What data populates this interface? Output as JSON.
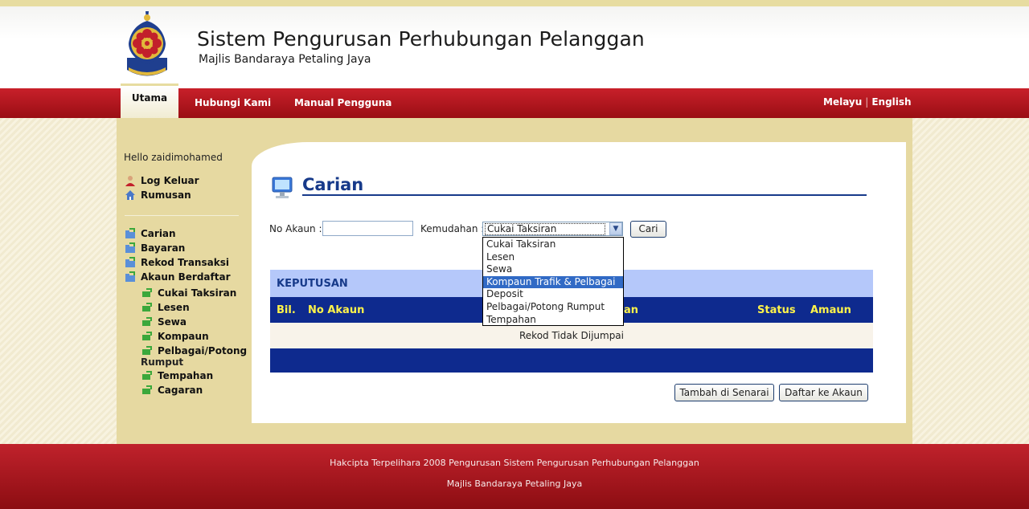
{
  "header": {
    "title": "Sistem Pengurusan Perhubungan Pelanggan",
    "subtitle": "Majlis Bandaraya Petaling Jaya"
  },
  "nav": {
    "items": [
      {
        "label": "Utama"
      },
      {
        "label": "Hubungi Kami"
      },
      {
        "label": "Manual Pengguna"
      }
    ],
    "lang": [
      "Melayu",
      "English"
    ],
    "lang_sep": "|"
  },
  "sidebar": {
    "hello": "Hello zaidimohamed",
    "top_items": [
      {
        "label": "Log Keluar",
        "icon": "user-icon"
      },
      {
        "label": "Rumusan",
        "icon": "home-icon"
      }
    ],
    "items": [
      {
        "label": "Carian",
        "icon": "folder-icon"
      },
      {
        "label": "Bayaran",
        "icon": "folder-icon"
      },
      {
        "label": "Rekod Transaksi",
        "icon": "folder-icon"
      },
      {
        "label": "Akaun Berdaftar",
        "icon": "folder-icon"
      }
    ],
    "sub_items": [
      {
        "label": "Cukai Taksiran"
      },
      {
        "label": "Lesen"
      },
      {
        "label": "Sewa"
      },
      {
        "label": "Kompaun"
      },
      {
        "label": "Pelbagai/Potong",
        "label2": "Rumput"
      },
      {
        "label": "Tempahan"
      },
      {
        "label": "Cagaran"
      }
    ]
  },
  "main": {
    "title": "Carian",
    "form": {
      "akaun_label": "No Akaun :",
      "akaun_value": "",
      "kemudahan_label": "Kemudahan :",
      "kemudahan_value": "Cukai Taksiran",
      "cari_label": "Cari"
    },
    "dropdown_options": [
      "Cukai Taksiran",
      "Lesen",
      "Sewa",
      "Kompaun Trafik & Pelbagai",
      "Deposit",
      "Pelbagai/Potong Rumput",
      "Tempahan"
    ],
    "dropdown_selected_index": 3,
    "results": {
      "heading": "KEPUTUSAN",
      "columns": [
        "Bil.",
        "No Akaun",
        "an",
        "Status",
        "Amaun"
      ],
      "empty_text": "Rekod Tidak Dijumpai"
    },
    "buttons": {
      "tambah": "Tambah di Senarai",
      "daftar": "Daftar ke Akaun"
    }
  },
  "footer": {
    "line1": "Hakcipta Terpelihara 2008 Pengurusan Sistem Pengurusan Perhubungan Pelanggan",
    "line2": "Majlis Bandaraya Petaling Jaya"
  },
  "colors": {
    "nav_red": "#b3151d",
    "title_blue": "#173a8a",
    "table_header": "#0e2a8e",
    "table_header_text": "#fff34a",
    "keputusan_bg": "#b5c8fa",
    "selected_option": "#316ac5"
  }
}
